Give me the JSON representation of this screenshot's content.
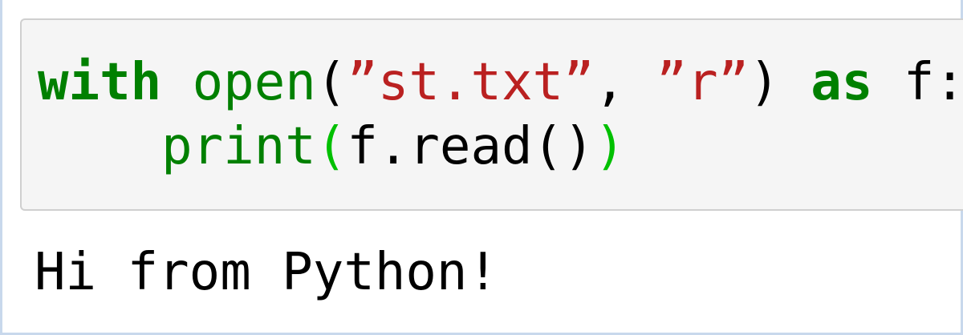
{
  "cell": {
    "code": {
      "line1": {
        "kw_with": "with",
        "sp1": " ",
        "fn_open": "open",
        "paren_open": "(",
        "str_file": "”st.txt”",
        "comma": ", ",
        "str_mode": "”r”",
        "paren_close": ")",
        "sp2": " ",
        "kw_as": "as",
        "var_f": " f:"
      },
      "line2": {
        "indent": "    ",
        "fn_print": "print",
        "paren_open": "(",
        "call": "f.read()",
        "paren_close": ")"
      }
    },
    "output": "Hi from Python!"
  },
  "colors": {
    "keyword": "#008000",
    "builtin": "#008000",
    "string": "#ba2121",
    "outer_paren": "#00c000",
    "input_bg": "#f5f5f5",
    "input_border": "#cfcfcf",
    "cell_border": "#c8d8ec"
  }
}
